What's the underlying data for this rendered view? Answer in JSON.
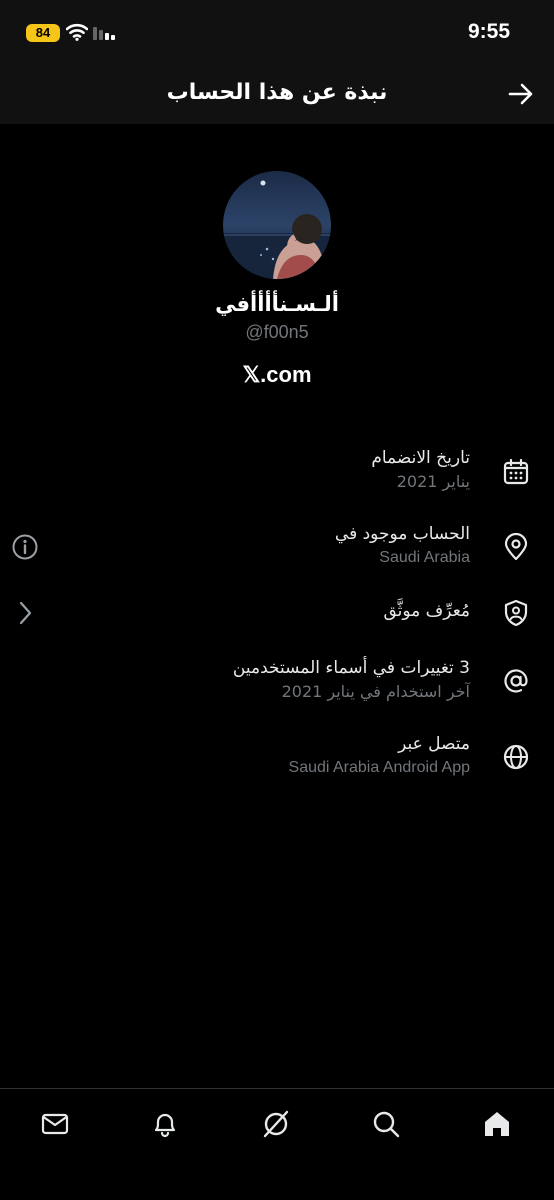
{
  "status_bar": {
    "time": "9:55",
    "battery_level": "84"
  },
  "header": {
    "title": "نبذة عن هذا الحساب"
  },
  "profile": {
    "display_name": "ألـسـنأأأأفي",
    "handle": "@f00n5",
    "site": "𝕏.com"
  },
  "info": {
    "joined_label": "تاريخ الانضمام",
    "joined_value": "يناير 2021",
    "location_label": "الحساب موجود في",
    "location_value": "Saudi Arabia",
    "verified_label": "مُعرِّف موثَّق",
    "username_changes_label": "3 تغييرات في أسماء المستخدمين",
    "username_changes_value": "آخر استخدام في يناير 2021",
    "connected_label": "متصل عبر",
    "connected_value": "Saudi Arabia Android App"
  },
  "tabs": {
    "icons": [
      "mail-icon",
      "bell-icon",
      "grok-icon",
      "search-icon",
      "home-icon"
    ]
  },
  "colors": {
    "background": "#000000",
    "header_bg": "#111111",
    "primary_text": "#e7e9ea",
    "secondary_text": "#71767b",
    "battery": "#f5c518"
  }
}
